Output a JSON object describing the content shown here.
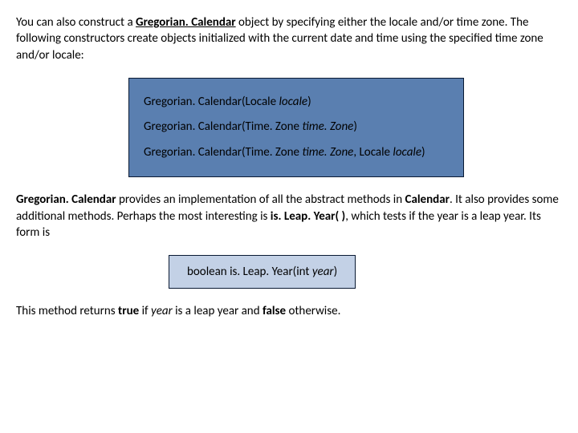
{
  "para1": {
    "t1": "You can also construct a ",
    "t2": "Gregorian. Calendar",
    "t3": " object by specifying either the locale and/or time zone. The following constructors create objects initialized with the current date and time using the specified time zone and/or locale:"
  },
  "sig": {
    "line1": {
      "a": "Gregorian. Calendar(Locale ",
      "b": "locale",
      "c": ")"
    },
    "line2": {
      "a": "Gregorian. Calendar(Time. Zone ",
      "b": "time. Zone",
      "c": ")"
    },
    "line3": {
      "a": "Gregorian. Calendar(Time. Zone ",
      "b": "time. Zone",
      "c": ", Locale ",
      "d": "locale",
      "e": ")"
    }
  },
  "para2": {
    "t1": "Gregorian. Calendar",
    "t2": " provides an implementation of all the abstract methods in ",
    "t3": "Calendar",
    "t4": ". It also provides some additional methods. Perhaps the most interesting is ",
    "t5": "is. Leap. Year( )",
    "t6": ", which tests if the year is a leap year. Its form is"
  },
  "method": {
    "a": "boolean is. Leap. Year(int ",
    "b": "year",
    "c": ")"
  },
  "para3": {
    "t1": "This method returns ",
    "t2": "true",
    "t3": " if ",
    "t4": "year",
    "t5": " is a leap year and ",
    "t6": "false",
    "t7": " otherwise."
  }
}
